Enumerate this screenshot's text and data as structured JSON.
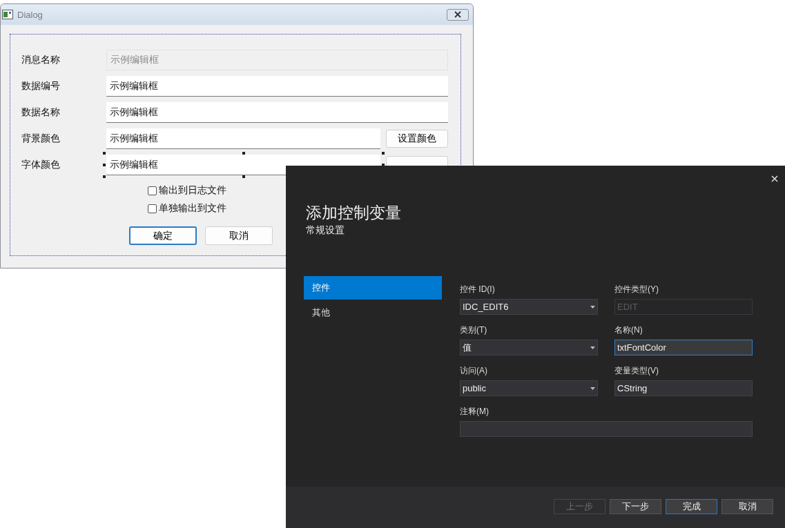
{
  "dialog": {
    "title": "Dialog",
    "rows": [
      {
        "label": "消息名称",
        "value": "示例编辑框",
        "disabled": true,
        "selected": false,
        "color_button": false
      },
      {
        "label": "数据编号",
        "value": "示例编辑框",
        "disabled": false,
        "selected": false,
        "color_button": false
      },
      {
        "label": "数据名称",
        "value": "示例编辑框",
        "disabled": false,
        "selected": false,
        "color_button": false
      },
      {
        "label": "背景颜色",
        "value": "示例编辑框",
        "disabled": false,
        "selected": false,
        "color_button": true,
        "button": "设置颜色"
      },
      {
        "label": "字体颜色",
        "value": "示例编辑框",
        "disabled": false,
        "selected": true,
        "color_button": true
      }
    ],
    "checkboxes": [
      {
        "label": "输出到日志文件",
        "checked": false
      },
      {
        "label": "单独输出到文件",
        "checked": false
      }
    ],
    "buttons": [
      {
        "label": "确定",
        "default": true
      },
      {
        "label": "取消",
        "default": false
      }
    ]
  },
  "wizard": {
    "title": "添加控制变量",
    "subtitle": "常规设置",
    "nav": [
      {
        "label": "控件",
        "selected": true
      },
      {
        "label": "其他",
        "selected": false
      }
    ],
    "fields": [
      {
        "label": "控件 ID(I)",
        "value": "IDC_EDIT6",
        "kind": "dropdown",
        "disabled": false,
        "focused": false
      },
      {
        "label": "控件类型(Y)",
        "value": "EDIT",
        "kind": "text",
        "disabled": true,
        "focused": false
      },
      {
        "label": "类别(T)",
        "value": "值",
        "kind": "dropdown",
        "disabled": false,
        "focused": false
      },
      {
        "label": "名称(N)",
        "value": "txtFontColor",
        "kind": "text",
        "disabled": false,
        "focused": true
      },
      {
        "label": "访问(A)",
        "value": "public",
        "kind": "dropdown",
        "disabled": false,
        "focused": false
      },
      {
        "label": "变量类型(V)",
        "value": "CString",
        "kind": "text",
        "disabled": false,
        "focused": false
      },
      {
        "label": "注释(M)",
        "kind": "wide",
        "disabled": false,
        "focused": false
      }
    ],
    "buttons": [
      {
        "label": "上一步",
        "disabled": true,
        "default": false
      },
      {
        "label": "下一步",
        "disabled": false,
        "default": false
      },
      {
        "label": "完成",
        "disabled": false,
        "default": true
      },
      {
        "label": "取消",
        "disabled": false,
        "default": false
      }
    ]
  }
}
